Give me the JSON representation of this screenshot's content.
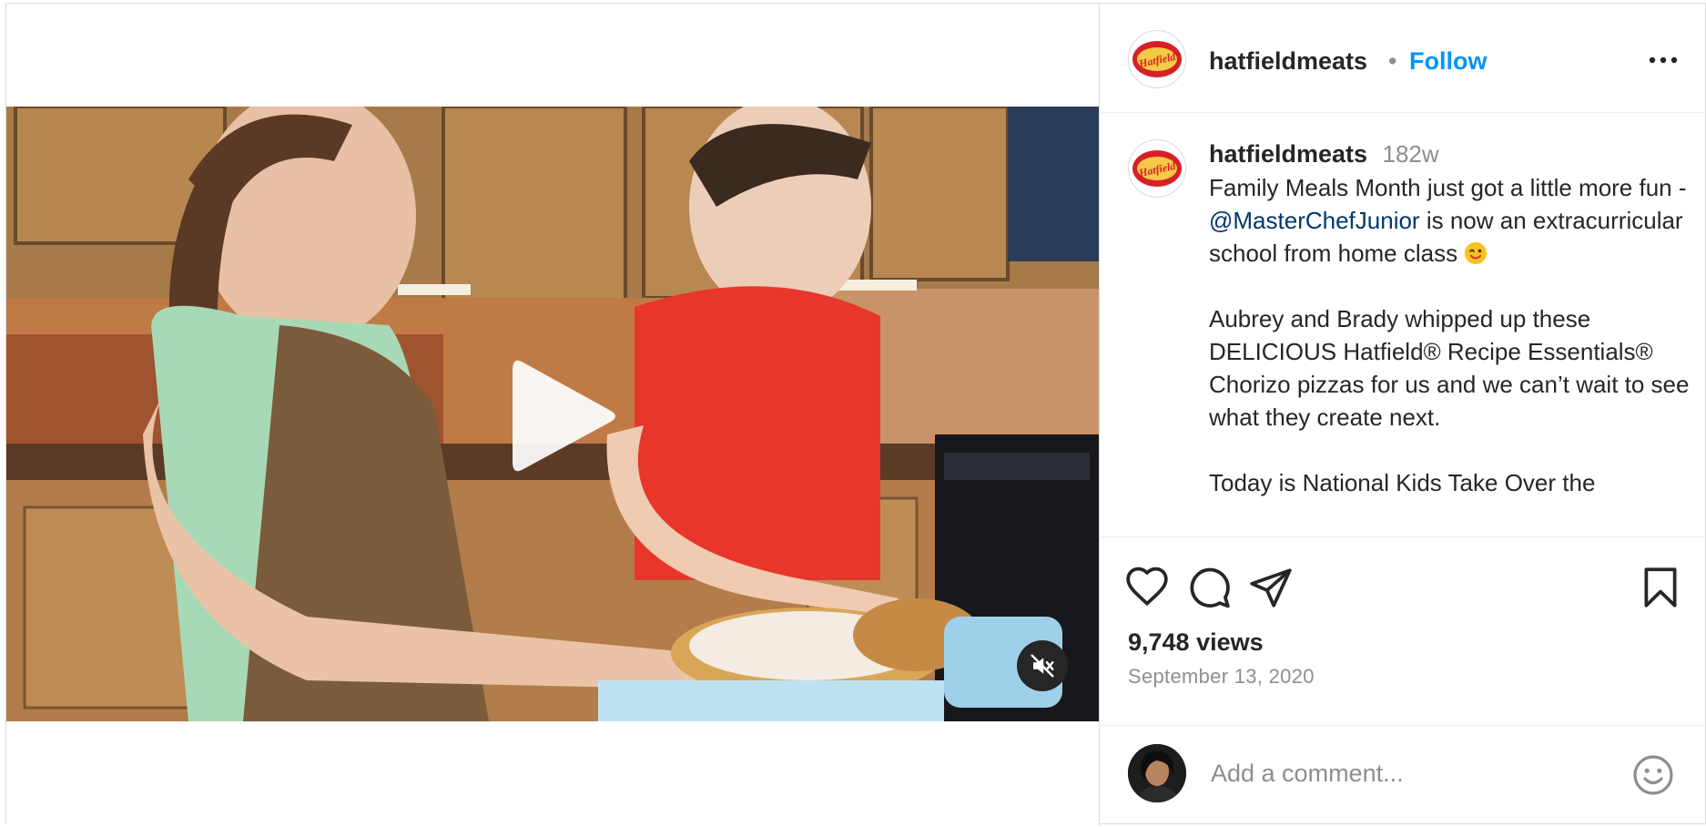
{
  "post": {
    "username": "hatfieldmeats",
    "follow_label": "Follow",
    "separator": "•",
    "brand_logo_text": "Hatfield",
    "time_ago": "182w",
    "caption": {
      "line1_pre": "Family Meals Month just got a little more fun - ",
      "mention": "@MasterChefJunior",
      "line1_post": " is now an extracurricular school from home class ",
      "paragraph2": "Aubrey and Brady whipped up these DELICIOUS Hatfield® Recipe Essentials® Chorizo pizzas for us and we can’t wait to see what they create next.",
      "paragraph3": "Today is National Kids Take Over the"
    },
    "views": "9,748 views",
    "date": "September 13, 2020"
  },
  "comment_box": {
    "placeholder": "Add a comment..."
  },
  "icons": {
    "more": "more-options-icon",
    "like": "heart-icon",
    "comment": "comment-icon",
    "share": "paper-plane-icon",
    "save": "bookmark-icon",
    "play": "play-icon",
    "mute": "speaker-muted-icon",
    "emoji": "smiley-icon",
    "wink": "winking-face-emoji"
  },
  "colors": {
    "follow": "#0095f6",
    "mention": "#00376b",
    "secondary_text": "#8e8e8e",
    "border": "#dbdbdb"
  }
}
